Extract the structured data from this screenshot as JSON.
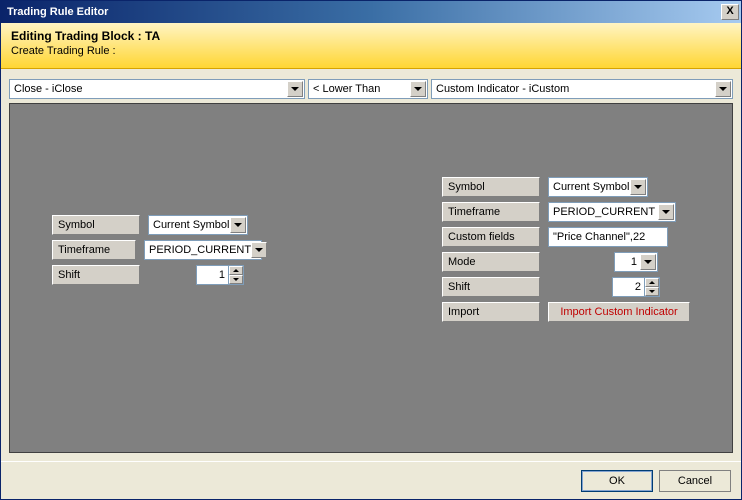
{
  "window": {
    "title": "Trading Rule Editor"
  },
  "banner": {
    "title": "Editing Trading Block : TA",
    "subtitle": "Create Trading Rule :"
  },
  "combos": {
    "left": "Close - iClose",
    "operator": "< Lower Than",
    "right": "Custom Indicator - iCustom"
  },
  "leftPanel": {
    "symbol_label": "Symbol",
    "symbol_value": "Current Symbol",
    "timeframe_label": "Timeframe",
    "timeframe_value": "PERIOD_CURRENT",
    "shift_label": "Shift",
    "shift_value": "1"
  },
  "rightPanel": {
    "symbol_label": "Symbol",
    "symbol_value": "Current Symbol",
    "timeframe_label": "Timeframe",
    "timeframe_value": "PERIOD_CURRENT",
    "custom_label": "Custom fields",
    "custom_value": "\"Price Channel\",22",
    "mode_label": "Mode",
    "mode_value": "1",
    "shift_label": "Shift",
    "shift_value": "2",
    "import_label": "Import",
    "import_button": "Import Custom Indicator"
  },
  "footer": {
    "ok": "OK",
    "cancel": "Cancel"
  }
}
